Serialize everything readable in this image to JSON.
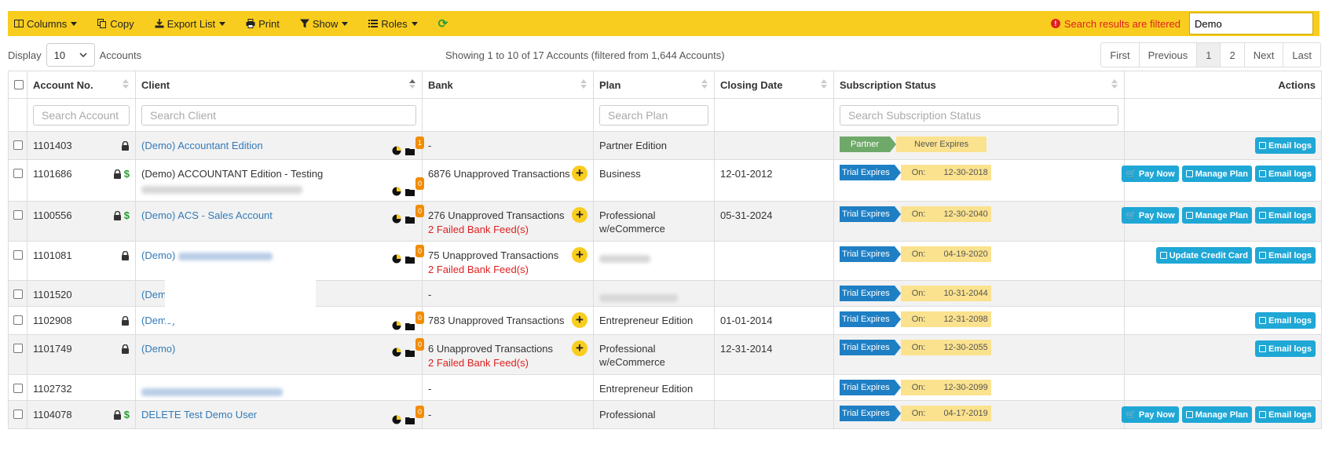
{
  "toolbar": {
    "columns": "Columns",
    "copy": "Copy",
    "export": "Export List",
    "print": "Print",
    "show": "Show",
    "roles": "Roles",
    "filtered_msg": "Search results are filtered",
    "search_value": "Demo"
  },
  "controls": {
    "display_label": "Display",
    "page_size": "10",
    "accounts_label": "Accounts",
    "showing": "Showing 1 to 10 of 17 Accounts (filtered from 1,644 Accounts)",
    "pager": [
      "First",
      "Previous",
      "1",
      "2",
      "Next",
      "Last"
    ]
  },
  "columns": {
    "account": "Account No.",
    "client": "Client",
    "bank": "Bank",
    "plan": "Plan",
    "closing": "Closing Date",
    "status": "Subscription Status",
    "actions": "Actions"
  },
  "filters": {
    "account": "Search Account",
    "client": "Search Client",
    "plan": "Search Plan",
    "status": "Search Subscription Status"
  },
  "labels": {
    "on": "On:",
    "trial": "Trial Expires",
    "failed": "2 Failed Bank Feed(s)",
    "pay": "Pay Now",
    "manage": "Manage Plan",
    "email": "Email logs",
    "update_cc": "Update Credit Card",
    "dash": "-"
  },
  "rows": [
    {
      "account": "1101403",
      "client": "(Demo) Accountant Edition",
      "badge": "1",
      "bank": "-",
      "plan": "Partner Edition",
      "closing": "",
      "status_left": "Partner",
      "status_right": "Never Expires"
    },
    {
      "account": "1101686",
      "client": "(Demo) ACCOUNTANT Edition - Testing",
      "badge": "0",
      "bank": "6876 Unapproved Transactions",
      "plan": "Business",
      "closing": "12-01-2012",
      "status_date": "12-30-2018"
    },
    {
      "account": "1100556",
      "client": "(Demo) ACS - Sales Account",
      "badge": "0",
      "bank": "276 Unapproved Transactions",
      "plan": "Professional w/eCommerce",
      "closing": "05-31-2024",
      "status_date": "12-30-2040"
    },
    {
      "account": "1101081",
      "client": "(Demo)",
      "badge": "0",
      "bank": "75 Unapproved Transactions",
      "plan": "",
      "closing": "",
      "status_date": "04-19-2020"
    },
    {
      "account": "1101520",
      "client": "(Demo)",
      "bank": "-",
      "plan": "",
      "closing": "",
      "status_date": "10-31-2044"
    },
    {
      "account": "1102908",
      "client": "(Demo)",
      "badge": "0",
      "bank": "783 Unapproved Transactions",
      "plan": "Entrepreneur Edition",
      "closing": "01-01-2014",
      "status_date": "12-31-2098"
    },
    {
      "account": "1101749",
      "client": "(Demo)",
      "badge": "0",
      "bank": "6 Unapproved Transactions",
      "plan": "Professional w/eCommerce",
      "closing": "12-31-2014",
      "status_date": "12-30-2055"
    },
    {
      "account": "1102732",
      "client": "",
      "bank": "-",
      "plan": "Entrepreneur Edition",
      "closing": "",
      "status_date": "12-30-2099"
    },
    {
      "account": "1104078",
      "client": "DELETE Test Demo User",
      "badge": "0",
      "bank": "-",
      "plan": "Professional",
      "closing": "",
      "status_date": "04-17-2019"
    }
  ],
  "colors": {
    "toolbar": "#f9cd1f",
    "trial": "#1f7fc4",
    "partner": "#6fa96a",
    "action": "#1fa7d6",
    "failed": "#e02020"
  }
}
